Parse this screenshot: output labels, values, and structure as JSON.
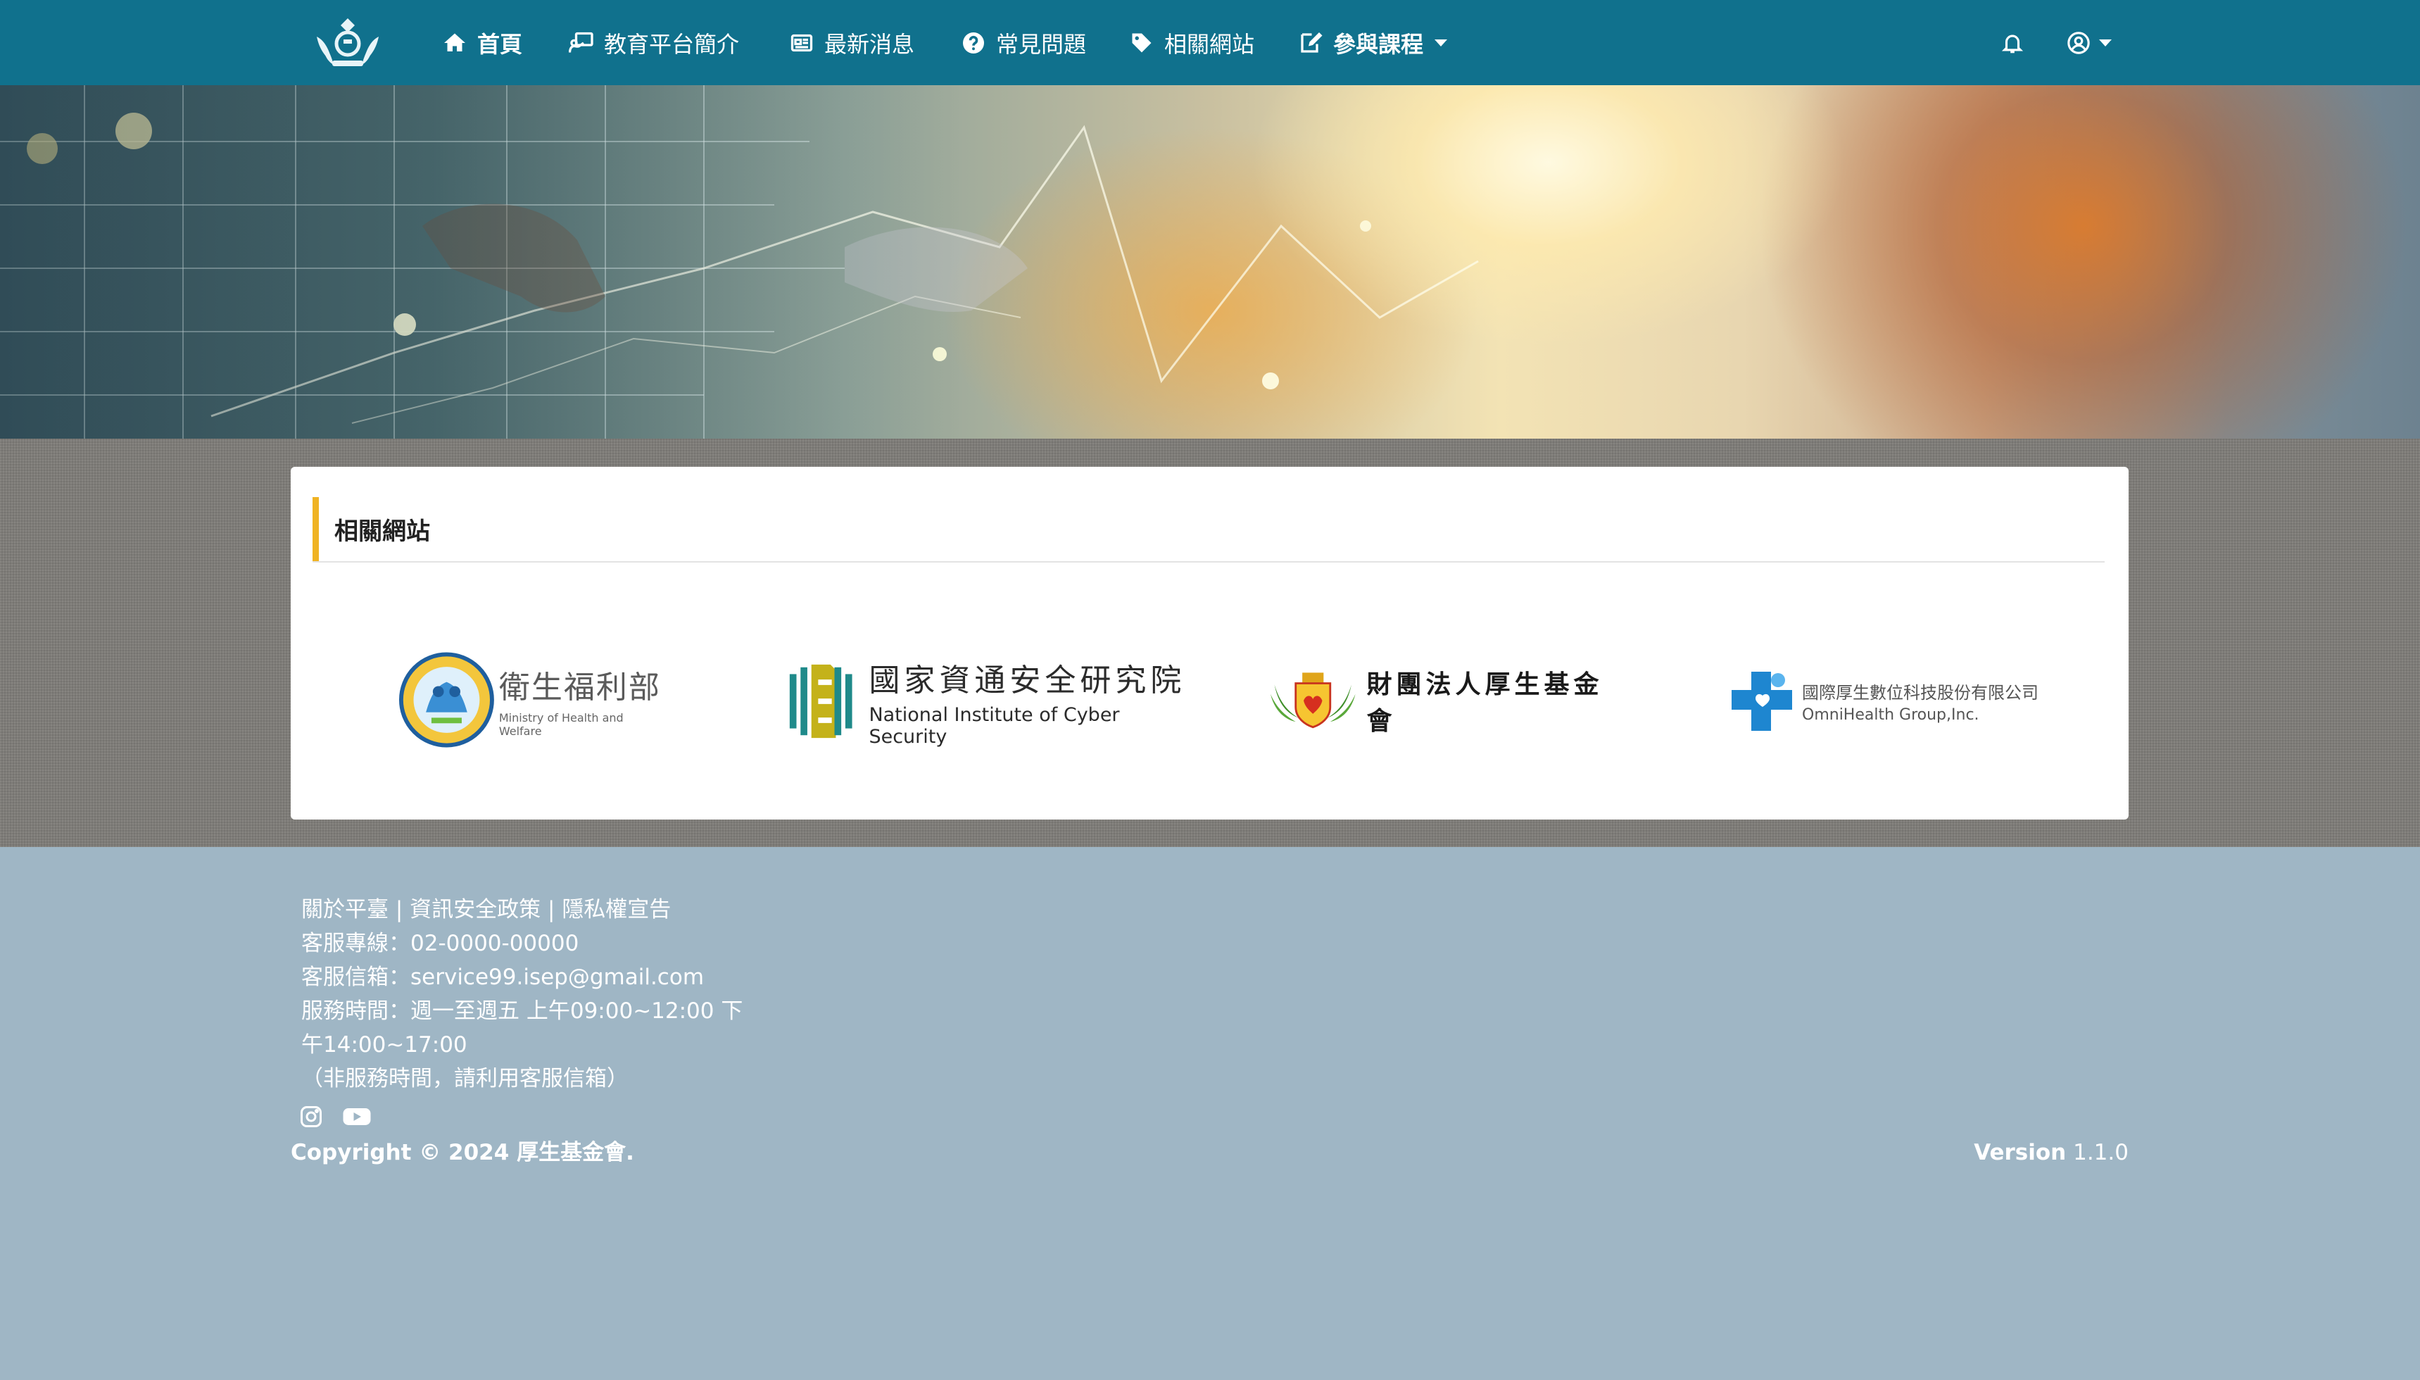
{
  "navbar": {
    "logo_name": "foundation-emblem",
    "items": [
      {
        "label": "首頁",
        "icon": "home-icon"
      },
      {
        "label": "教育平台簡介",
        "icon": "chalkboard-teacher-icon"
      },
      {
        "label": "最新消息",
        "icon": "newspaper-icon"
      },
      {
        "label": "常見問題",
        "icon": "question-circle-icon"
      },
      {
        "label": "相關網站",
        "icon": "tag-icon"
      },
      {
        "label": "參與課程",
        "icon": "edit-icon"
      }
    ],
    "notification_icon": "bell-icon",
    "user_icon": "user-circle-icon",
    "bg_color": "#10718d"
  },
  "card": {
    "title": "相關網站",
    "accent_color": "#f0b323",
    "logos": [
      {
        "name_zh": "衛生福利部",
        "name_en": "Ministry of Health and Welfare"
      },
      {
        "name_zh": "國家資通安全研究院",
        "name_en": "National Institute of Cyber Security"
      },
      {
        "name_zh": "財團法人厚生基金會",
        "name_en": ""
      },
      {
        "name_zh": "國際厚生數位科技股份有限公司",
        "name_en": "OmniHealth Group,Inc."
      }
    ]
  },
  "footer": {
    "links": [
      "關於平臺",
      "資訊安全政策",
      "隱私權宣告"
    ],
    "separator": " | ",
    "phone_line": "客服專線：02-0000-00000",
    "email_line": "客服信箱：service99.isep@gmail.com",
    "hours_line1": "服務時間：週一至週五 上午09:00~12:00 下",
    "hours_line2": "午14:00~17:00",
    "hours_note": "（非服務時間，請利用客服信箱）",
    "social": [
      "instagram-icon",
      "youtube-icon"
    ],
    "copyright": "Copyright © 2024 厚生基金會.",
    "version_label": "Version",
    "version_value": "1.1.0",
    "bg_color": "#9fb6c5"
  }
}
